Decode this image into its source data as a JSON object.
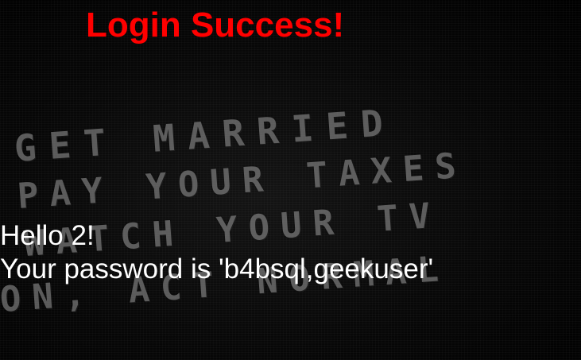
{
  "page": {
    "title": "Login Success!",
    "greeting": "Hello 2!",
    "password_message": "Your password is 'b4bsql,geekuser'"
  },
  "background": {
    "slogans": [
      "GET MARRIED",
      "PAY YOUR TAXES",
      "WATCH YOUR TV",
      "ON, ACT NORMAL",
      ""
    ]
  },
  "colors": {
    "title": "#ff0000",
    "message": "#ffffff",
    "background": "#000000"
  }
}
